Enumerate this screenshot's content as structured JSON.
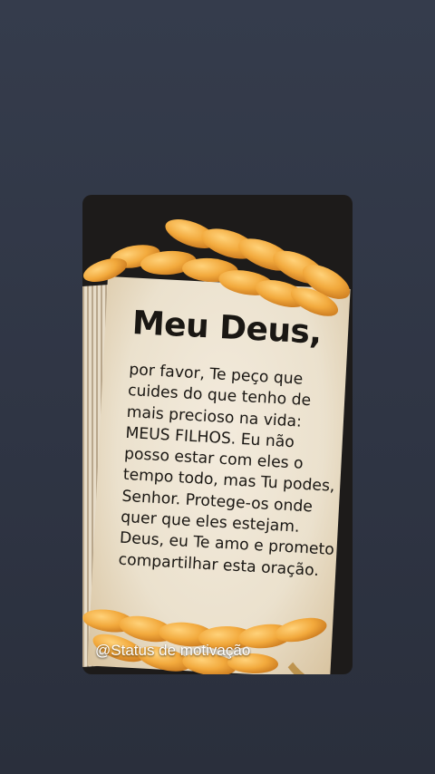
{
  "post": {
    "title": "Meu Deus,",
    "lines": [
      "por favor, Te peço que",
      "cuides do que tenho de",
      "mais precioso na vida:",
      "MEUS FILHOS. Eu não",
      "posso estar com eles o",
      "tempo todo, mas Tu podes,",
      "Senhor. Protege-os onde",
      "quer que eles estejam.",
      "Deus, eu Te amo e prometo",
      "compartilhar esta oração."
    ],
    "watermark": "@Status de motivação"
  },
  "colors": {
    "background": "#2f3544",
    "wheat": "#f2a93c",
    "paper": "#efe6d6"
  }
}
